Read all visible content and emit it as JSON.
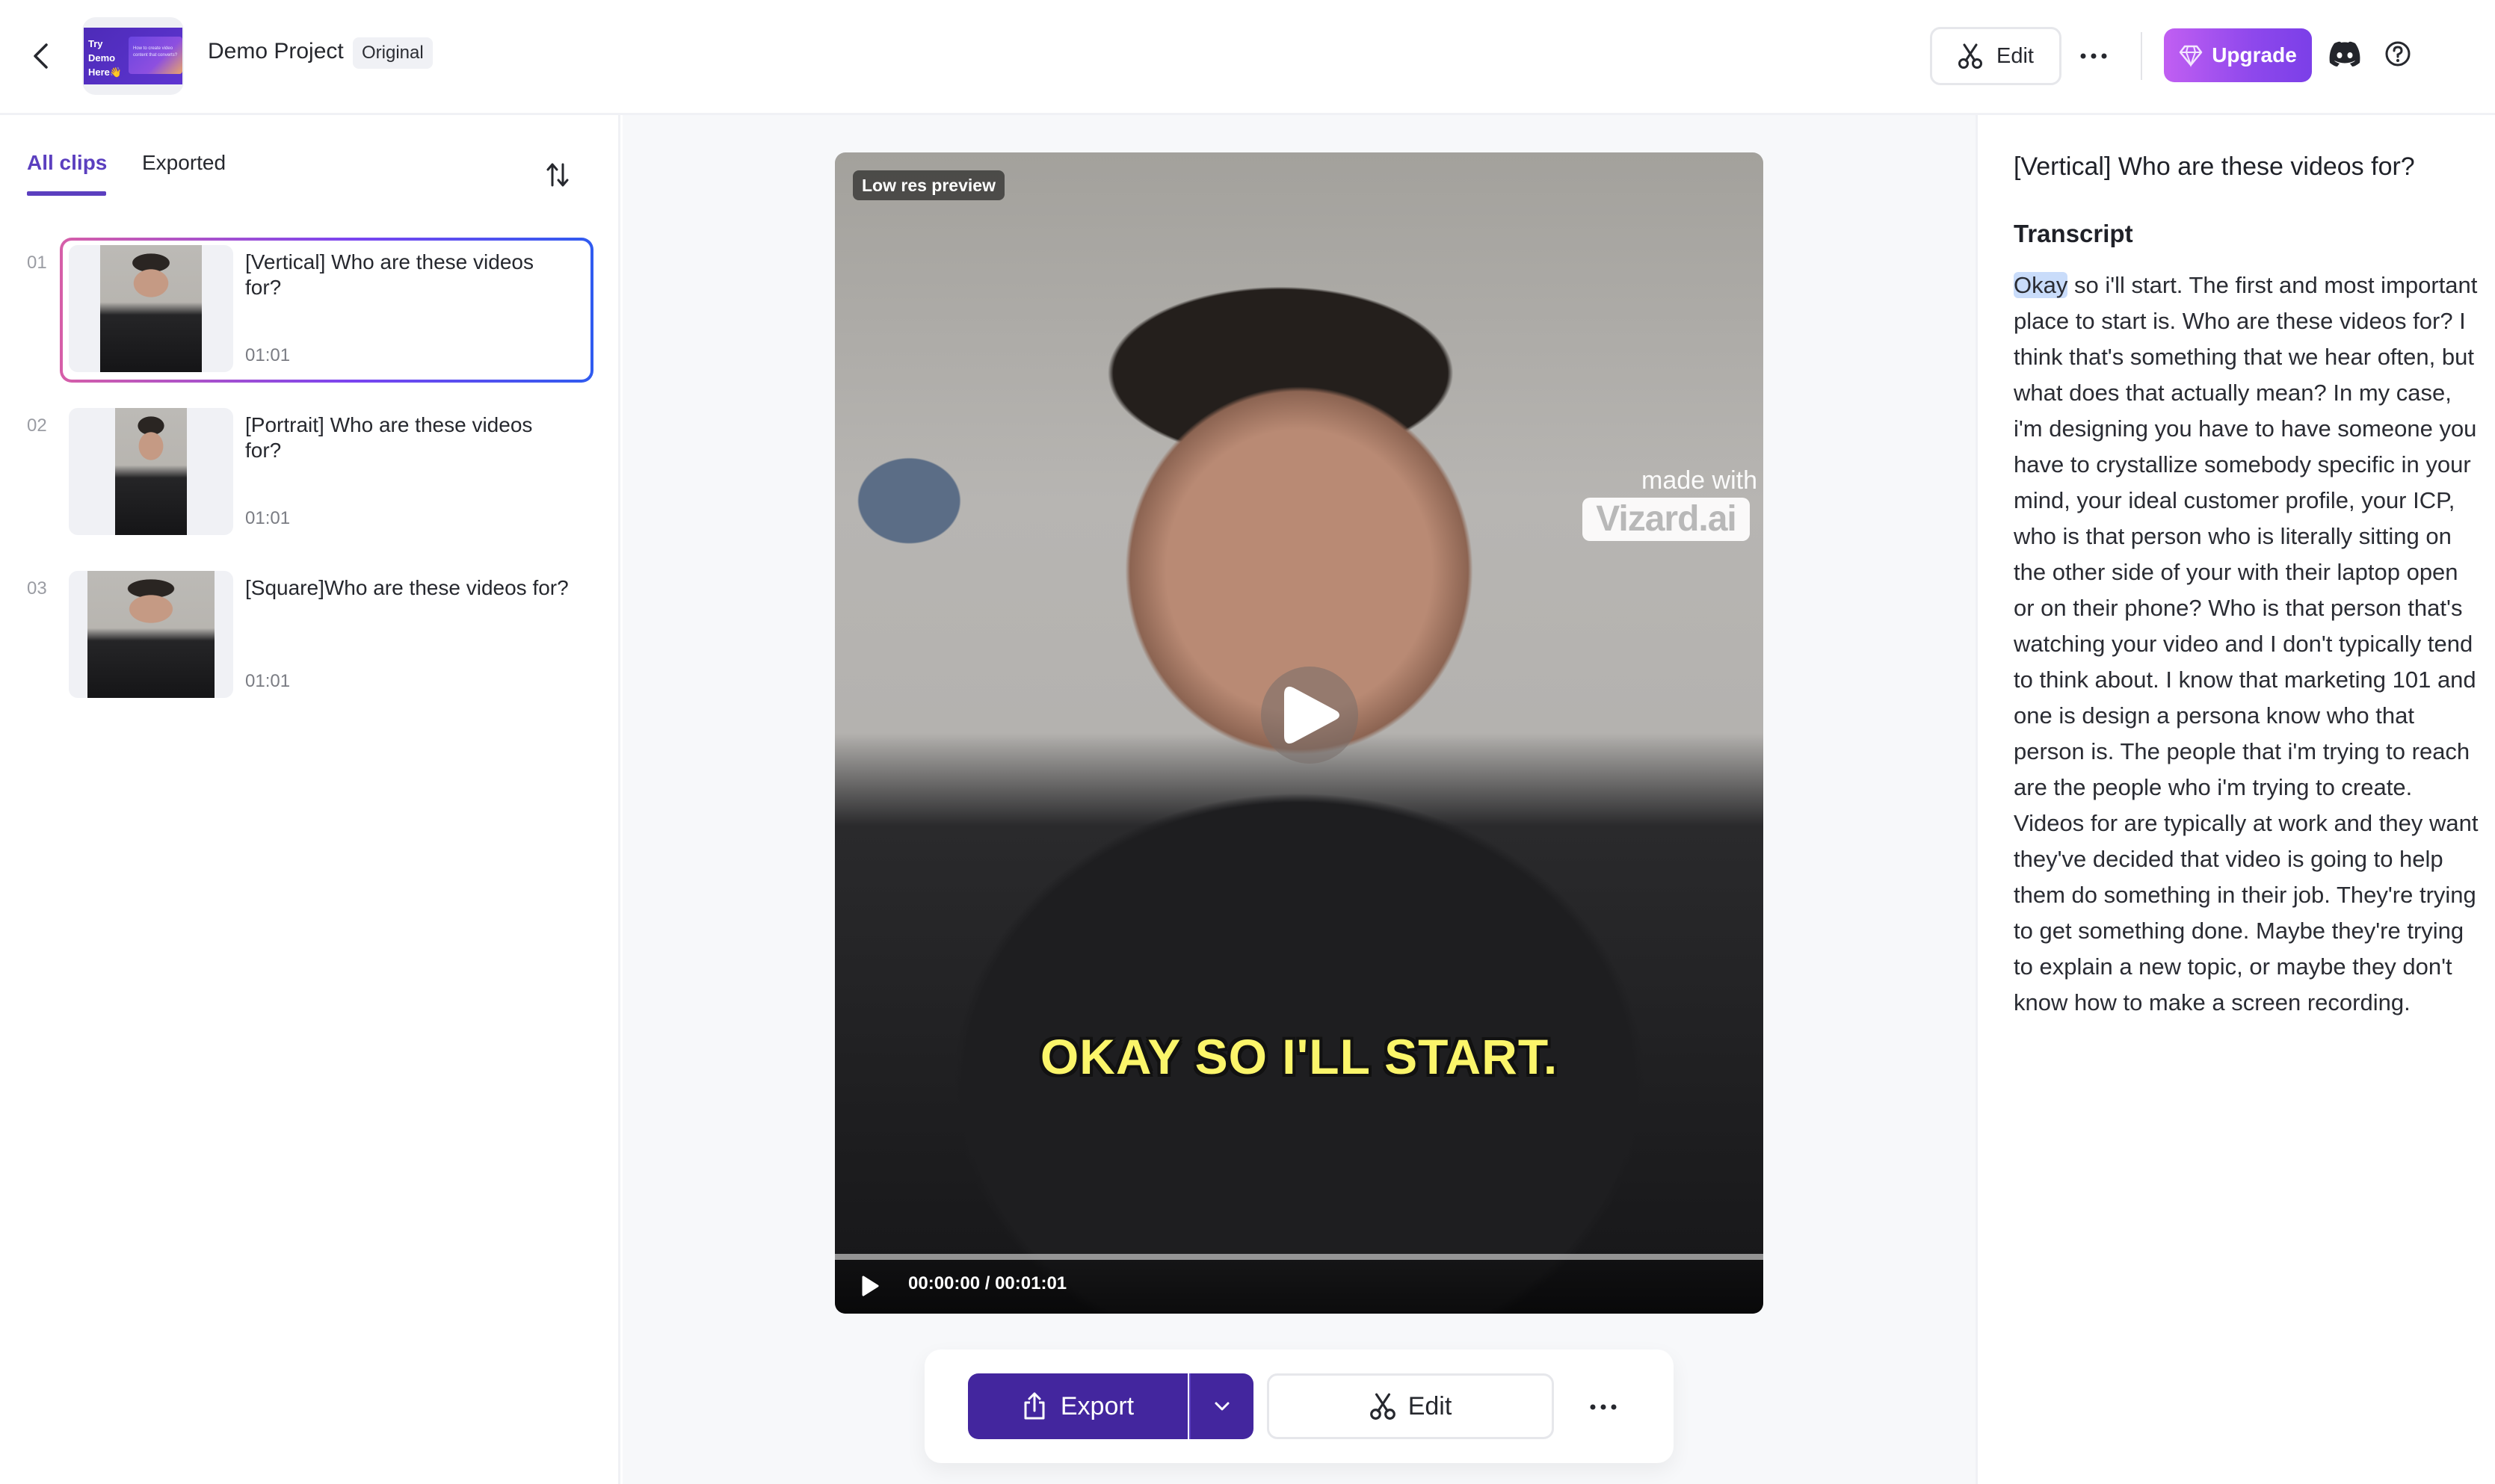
{
  "header": {
    "project_title": "Demo Project",
    "badge": "Original",
    "thumb_text": [
      "Try",
      "Demo",
      "Here👋"
    ],
    "thumb_card_text": "How to create video content that converts?",
    "edit_label": "Edit",
    "upgrade_label": "Upgrade",
    "icons": {
      "back": "chevron-left-icon",
      "edit": "scissors-icon",
      "more": "more-horizontal-icon",
      "upgrade": "diamond-icon",
      "discord": "discord-icon",
      "help": "help-circle-icon"
    },
    "upgrade_colors": [
      "#c15ff2",
      "#7b3fe8"
    ]
  },
  "clips_panel": {
    "tabs": [
      {
        "label": "All clips",
        "active": true
      },
      {
        "label": "Exported",
        "active": false
      }
    ],
    "sort_icon": "sort-arrows-icon",
    "accent": "#5b3fbf",
    "clips": [
      {
        "index": "01",
        "title": "[Vertical] Who are these videos for?",
        "duration": "01:01",
        "selected": true
      },
      {
        "index": "02",
        "title": "[Portrait] Who are these videos for?",
        "duration": "01:01",
        "selected": false
      },
      {
        "index": "03",
        "title": "[Square]Who are these videos for?",
        "duration": "01:01",
        "selected": false
      }
    ]
  },
  "player": {
    "badge": "Low res preview",
    "watermark_top": "made with",
    "watermark_brand": "Vizard.ai",
    "caption": "OKAY SO I'LL START.",
    "caption_color": "#fbf56a",
    "time_current": "00:00:00",
    "time_total": "00:01:01",
    "time_display": "00:00:00 / 00:01:01",
    "progress_fraction": 0.0
  },
  "actions": {
    "export_label": "Export",
    "edit_label": "Edit",
    "export_color": "#43269e",
    "icons": {
      "export": "share-upload-icon",
      "dropdown": "chevron-down-icon",
      "edit": "scissors-icon",
      "more": "more-horizontal-icon"
    }
  },
  "transcript": {
    "clip_title": "[Vertical] Who are these videos for?",
    "label": "Transcript",
    "highlighted_word": "Okay",
    "rest": " so i'll start. The first and most important place to start is. Who are these videos for? I think that's something that we hear often, but what does that actually mean? In my case, i'm designing you have to have someone you have to crystallize somebody specific in your mind, your ideal customer profile, your ICP, who is that person who is literally sitting on the other side of your with their laptop open or on their phone? Who is that person that's watching your video and I don't typically tend to think about. I know that marketing 101 and one is design a persona know who that person is. The people that i'm trying to reach are the people who i'm trying to create. Videos for are typically at work and they want they've decided that video is going to help them do something in their job. They're trying to get something done. Maybe they're trying to explain a new topic, or maybe they don't know how to make a screen recording."
  }
}
